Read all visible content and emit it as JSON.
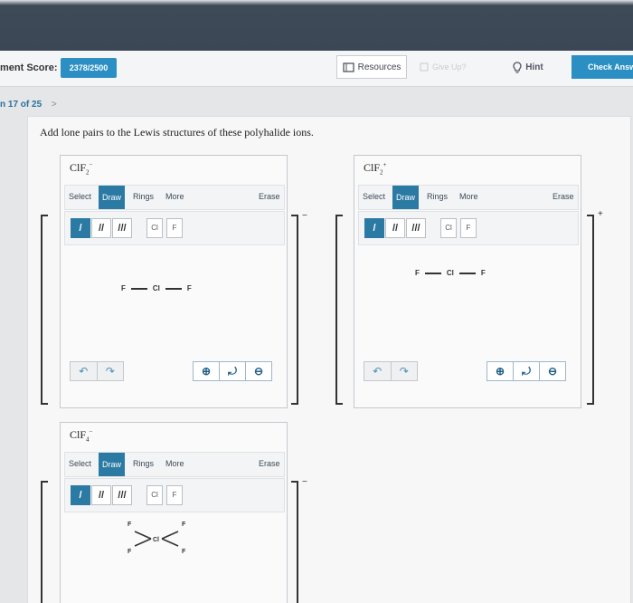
{
  "header": {
    "score_label": "ment Score:",
    "score_value": "2378/2500",
    "resources_label": "Resources",
    "give_up_label": "Give Up?",
    "hint_label": "Hint",
    "check_label": "Check Answer"
  },
  "nav": {
    "progress": "n 17 of 25",
    "next_arrow": ">"
  },
  "question": {
    "prompt": "Add lone pairs to the Lewis structures of these polyhalide ions."
  },
  "editor": {
    "menu": {
      "select": "Select",
      "draw": "Draw",
      "rings": "Rings",
      "more": "More",
      "erase": "Erase"
    },
    "bond_single": "/",
    "bond_double": "//",
    "bond_triple": "///",
    "atom_cl": "Cl",
    "atom_f": "F",
    "undo": "↶",
    "redo": "↷",
    "zoom_in": "⊕",
    "zoom_reset": "⤾",
    "zoom_out": "⊖"
  },
  "structures": [
    {
      "formula_main": "ClF",
      "formula_sub": "2",
      "formula_sup": "−",
      "charge": "−",
      "left_atom": "F",
      "center_atom": "Cl",
      "right_atom": "F"
    },
    {
      "formula_main": "ClF",
      "formula_sub": "2",
      "formula_sup": "+",
      "charge": "+",
      "left_atom": "F",
      "center_atom": "Cl",
      "right_atom": "F"
    },
    {
      "formula_main": "ClF",
      "formula_sub": "4",
      "formula_sup": "−",
      "charge": "−",
      "center_atom": "Cl",
      "atom_tl": "F",
      "atom_tr": "F",
      "atom_bl": "F",
      "atom_br": "F"
    }
  ],
  "colors": {
    "accent": "#2b8fc3",
    "draw_active": "#2b7aa3",
    "topbar": "#3b4754"
  }
}
